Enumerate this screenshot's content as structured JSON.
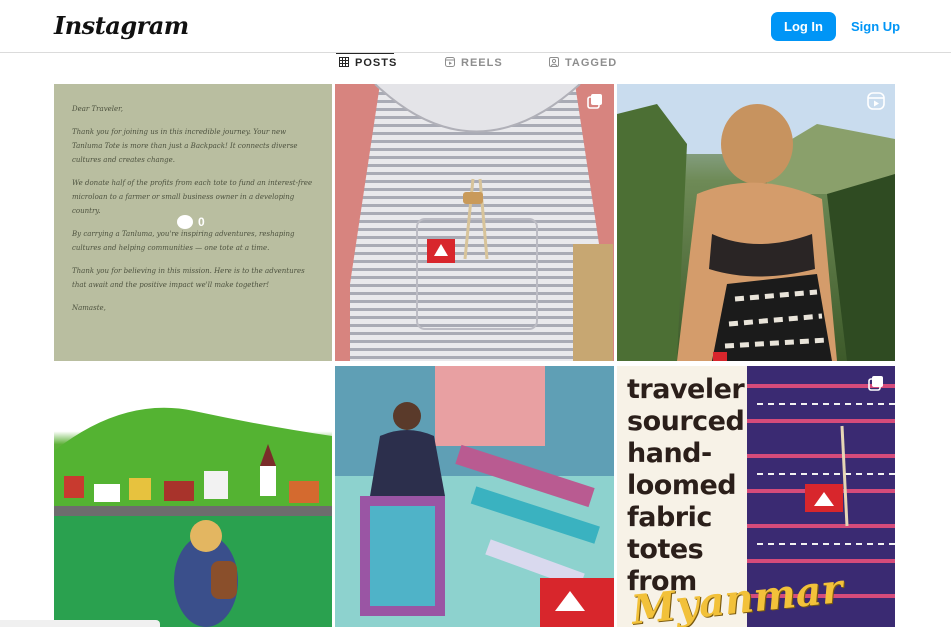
{
  "header": {
    "logo": "Instagram",
    "login_label": "Log In",
    "signup_label": "Sign Up"
  },
  "tabs": [
    {
      "label": "POSTS",
      "active": true,
      "icon": "grid-icon"
    },
    {
      "label": "REELS",
      "active": false,
      "icon": "reels-icon"
    },
    {
      "label": "TAGGED",
      "active": false,
      "icon": "tagged-icon"
    }
  ],
  "posts": [
    {
      "kind": "image",
      "comments": "0",
      "letter": [
        "Dear Traveler,",
        "Thank you for joining us in this incredible journey. Your new Tanluma Tote is more than just a Backpack! It connects diverse cultures and creates change.",
        "We donate half of the profits from each tote to fund an interest-free microloan to a farmer or small business owner in a developing country.",
        "By carrying a Tanluma, you're inspiring adventures, reshaping cultures and helping communities — one tote at a time.",
        "Thank you for believing in this mission. Here is to the adventures that await and the positive impact we'll make together!",
        "Namaste,"
      ]
    },
    {
      "kind": "carousel",
      "icon": "carousel-icon"
    },
    {
      "kind": "reel",
      "icon": "reel-icon"
    },
    {
      "kind": "image"
    },
    {
      "kind": "image"
    },
    {
      "kind": "carousel",
      "icon": "carousel-icon",
      "ad_lines": [
        "traveler",
        "sourced",
        "hand-",
        "loomed",
        "fabric",
        "totes",
        "from"
      ],
      "ad_script": "Myanmar"
    }
  ],
  "colors": {
    "accent": "#0095f6",
    "divider": "#dbdbdb"
  }
}
